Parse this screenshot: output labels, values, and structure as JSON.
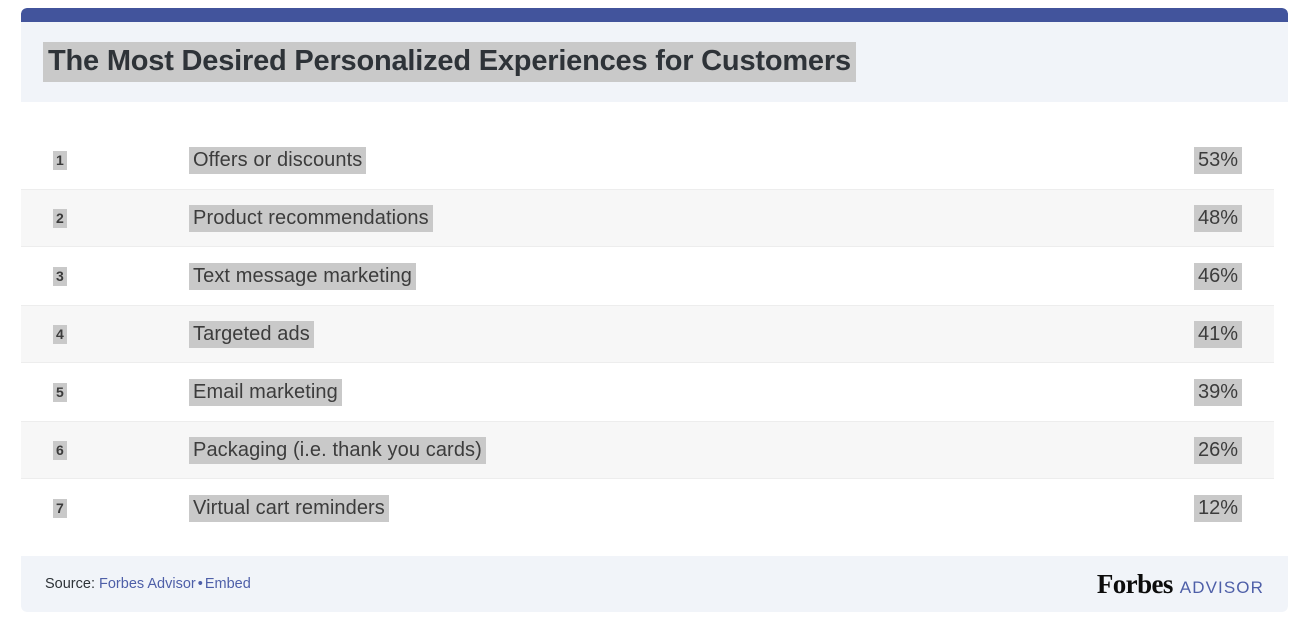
{
  "accent_color": "#42549C",
  "header": {
    "title": "The Most Desired Personalized Experiences for Customers",
    "background": "#F1F4F9",
    "highlight_color": "#C9C9C9"
  },
  "chart_data": {
    "type": "table",
    "title": "The Most Desired Personalized Experiences for Customers",
    "xlabel": "",
    "ylabel": "",
    "categories": [
      "Offers or discounts",
      "Product recommendations",
      "Text message marketing",
      "Targeted ads",
      "Email marketing",
      "Packaging (i.e. thank you cards)",
      "Virtual cart reminders"
    ],
    "values": [
      53,
      48,
      46,
      41,
      39,
      26,
      12
    ],
    "value_labels": [
      "53%",
      "48%",
      "46%",
      "41%",
      "39%",
      "26%",
      "12%"
    ],
    "ranks": [
      "1",
      "2",
      "3",
      "4",
      "5",
      "6",
      "7"
    ],
    "ylim": [
      0,
      100
    ],
    "grid": false,
    "legend": null
  },
  "rows": [
    {
      "rank": "1",
      "label": "Offers or discounts",
      "value": "53%"
    },
    {
      "rank": "2",
      "label": "Product recommendations",
      "value": "48%"
    },
    {
      "rank": "3",
      "label": "Text message marketing",
      "value": "46%"
    },
    {
      "rank": "4",
      "label": "Targeted ads",
      "value": "41%"
    },
    {
      "rank": "5",
      "label": "Email marketing",
      "value": "39%"
    },
    {
      "rank": "6",
      "label": "Packaging (i.e. thank you cards)",
      "value": "26%"
    },
    {
      "rank": "7",
      "label": "Virtual cart reminders",
      "value": "12%"
    }
  ],
  "footer": {
    "source_prefix": "Source:",
    "source_link": "Forbes Advisor",
    "separator": "•",
    "embed_link": "Embed",
    "brand_primary": "Forbes",
    "brand_secondary": "ADVISOR",
    "link_color": "#4E5FA8"
  }
}
